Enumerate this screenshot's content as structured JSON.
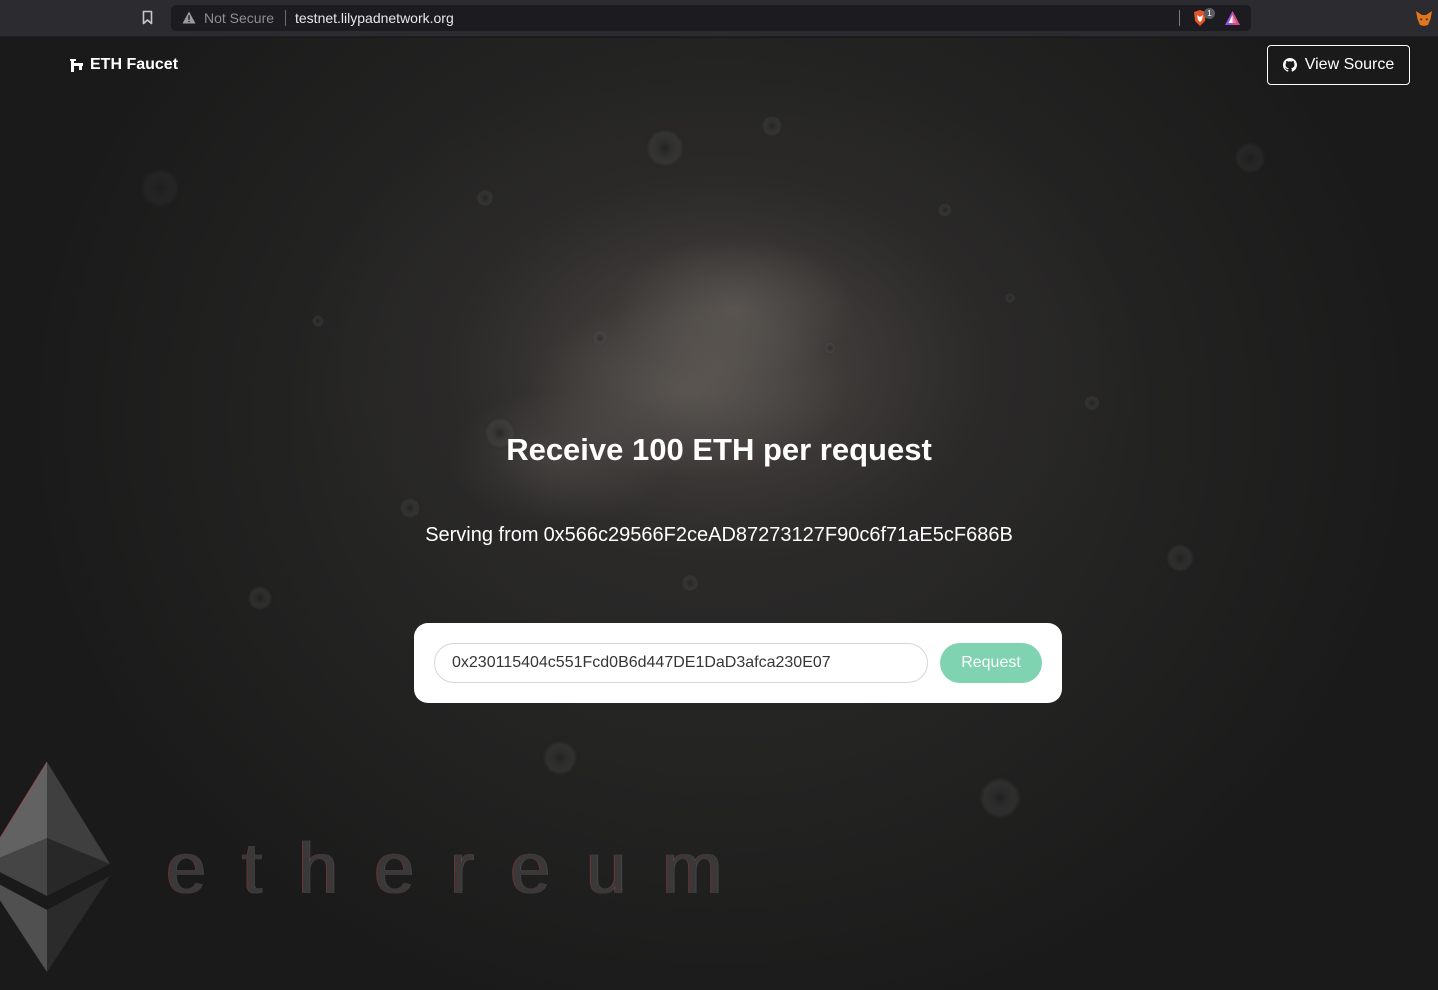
{
  "browser": {
    "security_label": "Not Secure",
    "url": "testnet.lilypadnetwork.org",
    "brave_badge_count": "1",
    "icons": [
      "bookmark-icon",
      "warning-icon",
      "brave-shield-icon",
      "brave-rewards-icon",
      "metamask-fox-icon"
    ]
  },
  "header": {
    "brand_label": "ETH Faucet",
    "brand_icon": "faucet-icon",
    "view_source_label": "View Source",
    "view_source_icon": "github-icon"
  },
  "main": {
    "headline": "Receive 100 ETH per request",
    "serving_prefix": "Serving from",
    "serving_address": "0x566c29566F2ceAD87273127F90c6f71aE5cF686B",
    "address_input_value": "0x230115404c551Fcd0B6d447DE1DaD3afca230E07",
    "request_button_label": "Request"
  },
  "background": {
    "wordmark": "ethereum"
  },
  "colors": {
    "accent": "#7fd3b1",
    "page_bg": "#1a1a1a",
    "card_bg": "#ffffff"
  }
}
